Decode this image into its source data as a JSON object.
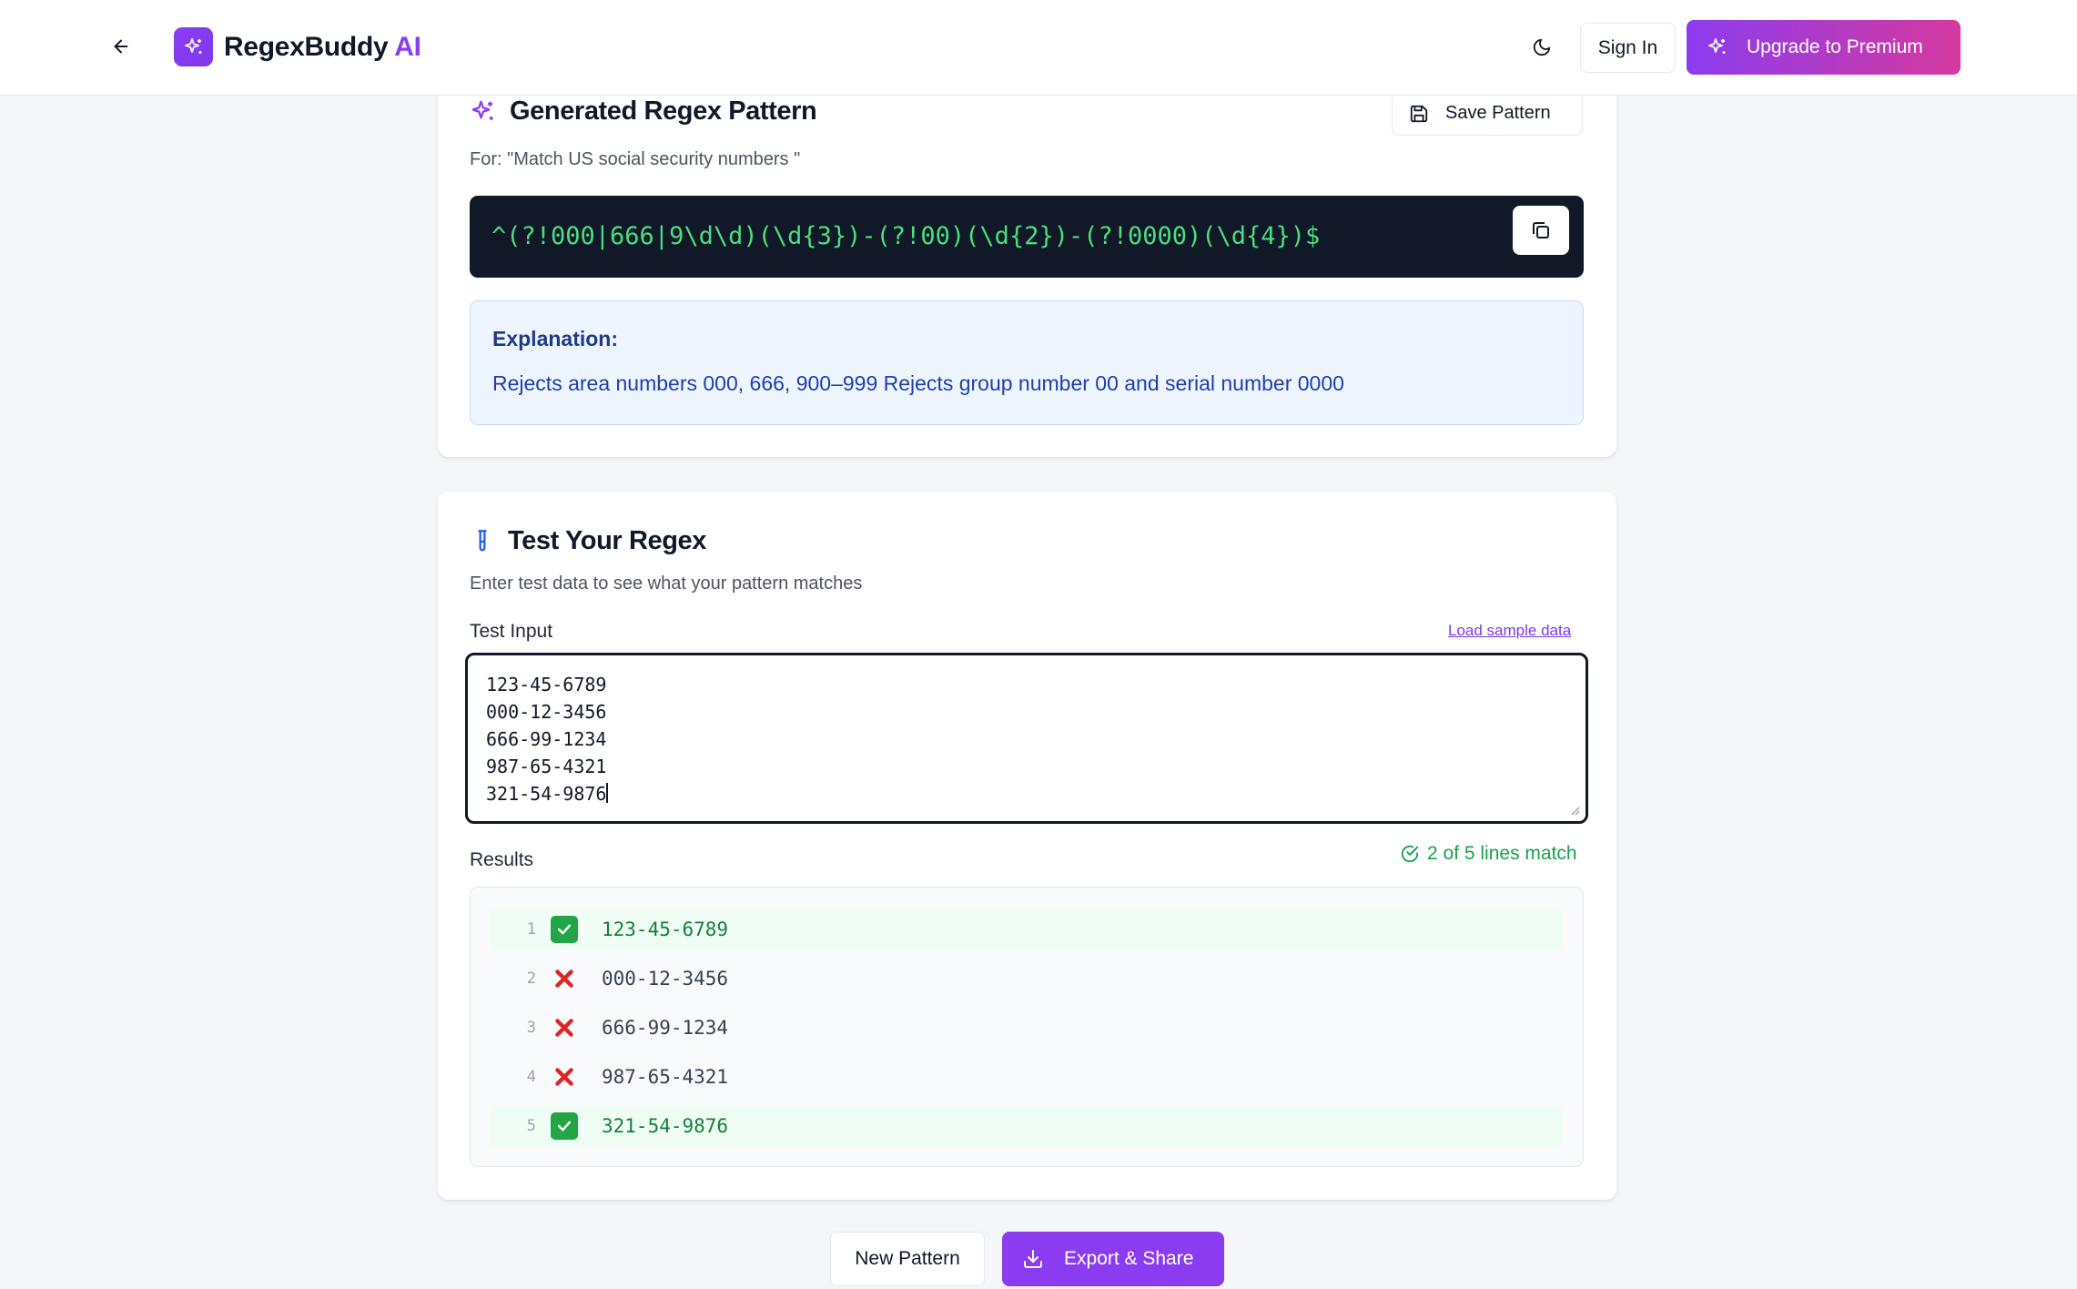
{
  "app": {
    "brand_main": "RegexBuddy",
    "brand_accent": "AI",
    "signin_label": "Sign In",
    "upgrade_label": "Upgrade to Premium"
  },
  "generated": {
    "title": "Generated Regex Pattern",
    "save_label": "Save Pattern",
    "for_text": "For: \"Match US social security numbers \"",
    "pattern": "^(?!000|666|9\\d\\d)(\\d{3})-(?!00)(\\d{2})-(?!0000)(\\d{4})$",
    "explanation_heading": "Explanation:",
    "explanation_text": "Rejects area numbers 000, 666, 900–999 Rejects group number 00 and serial number 0000"
  },
  "test": {
    "title": "Test Your Regex",
    "subtitle": "Enter test data to see what your pattern matches",
    "input_label": "Test Input",
    "load_sample_label": "Load sample data",
    "input_lines": [
      "123-45-6789",
      "000-12-3456",
      "666-99-1234",
      "987-65-4321",
      "321-54-9876"
    ],
    "results_label": "Results",
    "match_summary": "2 of 5 lines match",
    "results": [
      {
        "num": "1",
        "value": "123-45-6789",
        "match": true
      },
      {
        "num": "2",
        "value": "000-12-3456",
        "match": false
      },
      {
        "num": "3",
        "value": "666-99-1234",
        "match": false
      },
      {
        "num": "4",
        "value": "987-65-4321",
        "match": false
      },
      {
        "num": "5",
        "value": "321-54-9876",
        "match": true
      }
    ]
  },
  "footer": {
    "new_pattern_label": "New Pattern",
    "export_label": "Export & Share"
  },
  "colors": {
    "accent": "#8b3cf0",
    "accent_pink": "#d53a9d",
    "code_bg": "#111827",
    "code_text": "#4ade80",
    "match_green": "#16a34a",
    "reject_red": "#dc2626"
  }
}
